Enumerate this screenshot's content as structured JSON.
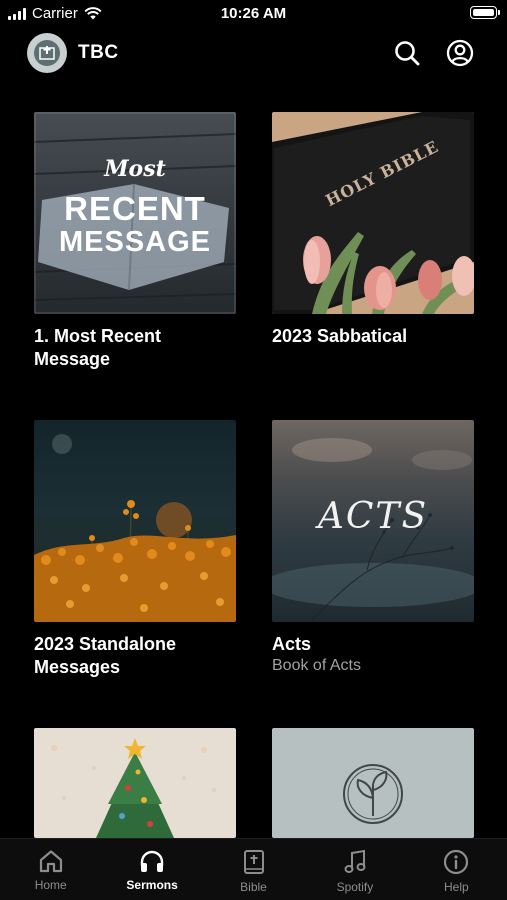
{
  "status_bar": {
    "carrier": "Carrier",
    "time": "10:26 AM"
  },
  "header": {
    "title": "TBC"
  },
  "cards": [
    {
      "title": "1. Most Recent Message",
      "subtitle": "",
      "art": {
        "line1": "Most",
        "line2": "RECENT",
        "line3": "MESSAGE"
      }
    },
    {
      "title": "2023 Sabbatical",
      "subtitle": "",
      "art": {
        "book_text": "HOLY BIBLE"
      }
    },
    {
      "title": "2023 Standalone Messages",
      "subtitle": ""
    },
    {
      "title": "Acts",
      "subtitle": "Book of Acts",
      "art": {
        "word": "ACTS"
      }
    },
    {
      "title": "",
      "subtitle": ""
    },
    {
      "title": "",
      "subtitle": ""
    }
  ],
  "tabs": [
    {
      "label": "Home",
      "icon": "home-icon",
      "active": false
    },
    {
      "label": "Sermons",
      "icon": "headphones-icon",
      "active": true
    },
    {
      "label": "Bible",
      "icon": "bible-icon",
      "active": false
    },
    {
      "label": "Spotify",
      "icon": "music-note-icon",
      "active": false
    },
    {
      "label": "Help",
      "icon": "info-icon",
      "active": false
    }
  ],
  "colors": {
    "background": "#000000",
    "active_tab": "#ffffff",
    "inactive_tab": "#8d8d8d",
    "subtitle": "#a2a2a2"
  }
}
